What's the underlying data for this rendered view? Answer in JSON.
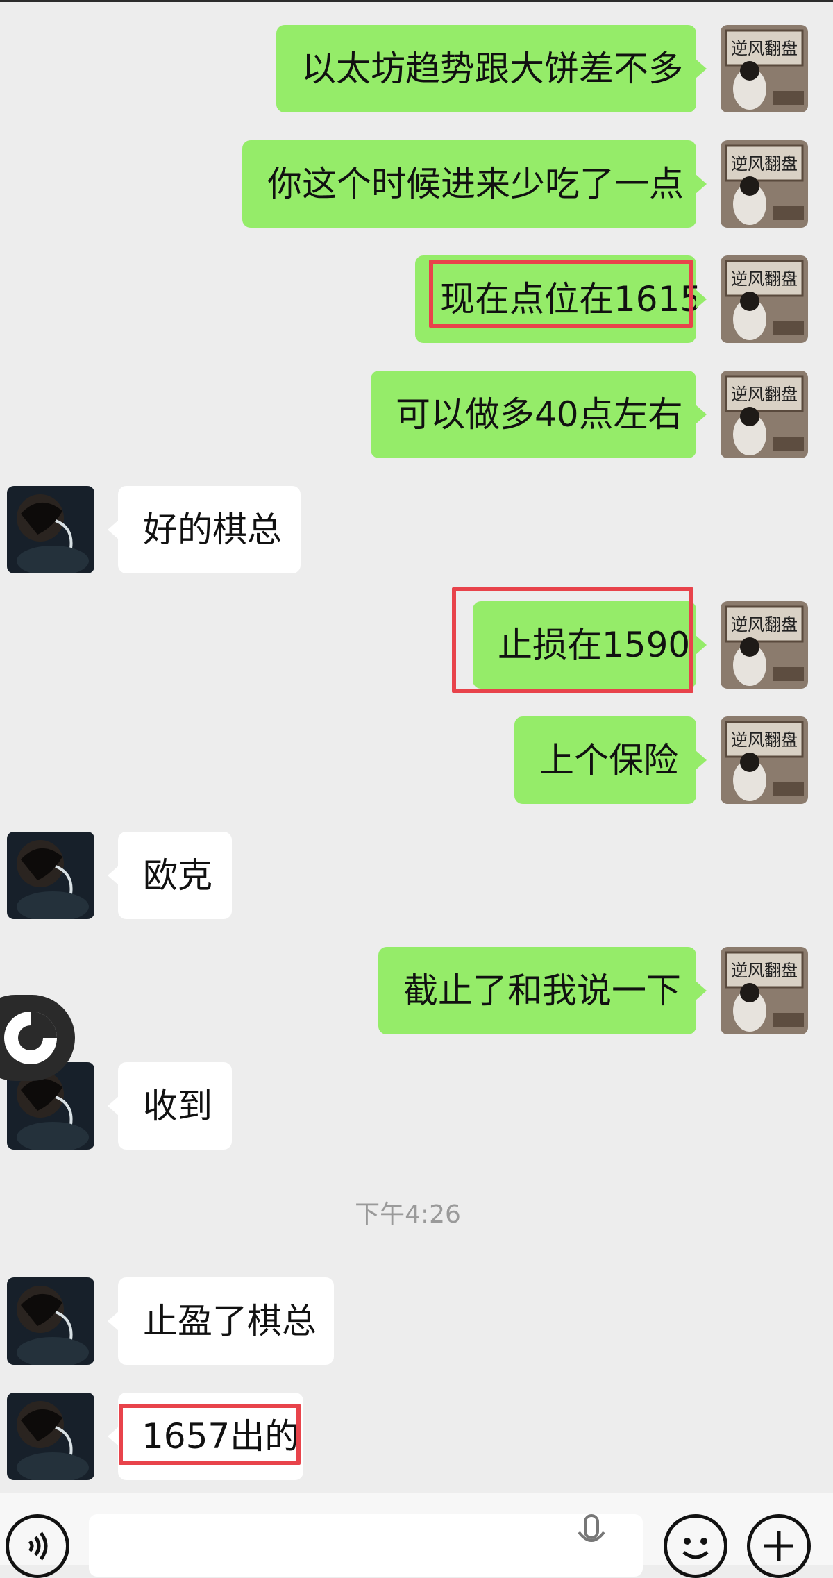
{
  "messages": [
    {
      "side": "right",
      "text": "以太坊趋势跟大饼差不多"
    },
    {
      "side": "right",
      "text": "你这个时候进来少吃了一点"
    },
    {
      "side": "right",
      "text": "现在点位在1615",
      "highlighted": true
    },
    {
      "side": "right",
      "text": "可以做多40点左右"
    },
    {
      "side": "left",
      "text": "好的棋总"
    },
    {
      "side": "right",
      "text": "止损在1590",
      "highlighted": true
    },
    {
      "side": "right",
      "text": "上个保险"
    },
    {
      "side": "left",
      "text": "欧克"
    },
    {
      "side": "right",
      "text": "截止了和我说一下"
    },
    {
      "side": "left",
      "text": "收到"
    },
    {
      "side": "left",
      "text": "止盈了棋总"
    },
    {
      "side": "left",
      "text": "1657出的",
      "highlighted": true
    }
  ],
  "timestamp": "下午4:26",
  "avatars": {
    "self_sign_text": "逆风翻盘"
  },
  "colors": {
    "outgoing_bubble": "#95ec69",
    "incoming_bubble": "#ffffff",
    "highlight_box": "#e8434b",
    "background": "#ededed"
  },
  "bottom_bar": {
    "icons": [
      "voice-icon",
      "microphone-icon",
      "emoji-icon",
      "plus-icon"
    ]
  }
}
